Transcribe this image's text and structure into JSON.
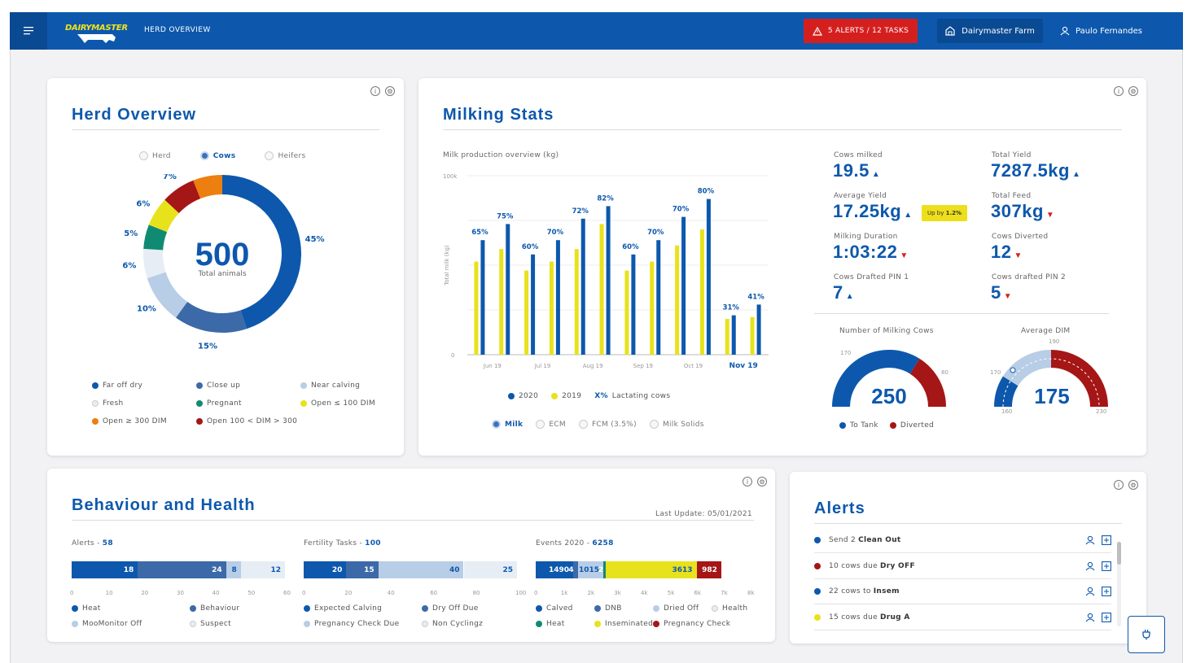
{
  "header": {
    "logo_text": "DAIRYMASTER",
    "breadcrumb": "HERD OVERVIEW",
    "alerts_label": "5 ALERTS / 12 TASKS",
    "farm_label": "Dairymaster Farm",
    "user_name": "Paulo Fernandes"
  },
  "herd": {
    "title": "Herd Overview",
    "radios": [
      "Herd",
      "Cows",
      "Heifers"
    ],
    "selected": "Cows",
    "total": "500",
    "total_label": "Total animals",
    "segments": [
      {
        "label": "Far off dry",
        "pct": "45%",
        "value": 45,
        "color": "#0d58ad"
      },
      {
        "label": "Close up",
        "pct": "15%",
        "value": 15,
        "color": "#3c6aa8"
      },
      {
        "label": "Near calving",
        "pct": "10%",
        "value": 10,
        "color": "#b8cde6"
      },
      {
        "label": "Fresh",
        "pct": "6%",
        "value": 6,
        "color": "#e6edf5"
      },
      {
        "label": "Pregnant",
        "pct": "5%",
        "value": 5,
        "color": "#118a73"
      },
      {
        "label": "Open ≤ 100 DIM",
        "pct": "6%",
        "value": 6,
        "color": "#e8e21c"
      },
      {
        "label": "Open 100 < DIM > 300",
        "pct": "7%",
        "value": 7,
        "color": "#a51616"
      },
      {
        "label": "Open ≥ 300 DIM",
        "pct": "6%",
        "value": 6,
        "color": "#ec7f10"
      }
    ],
    "legend_order": [
      "Far off dry",
      "Close up",
      "Near calving",
      "Fresh",
      "Pregnant",
      "Open ≤ 100 DIM",
      "Open ≥ 300 DIM",
      "Open 100 < DIM > 300"
    ]
  },
  "milking": {
    "title": "Milking Stats",
    "chart_caption": "Milk production overview (kg)",
    "radios": [
      "Milk",
      "ECM",
      "FCM (3.5%)",
      "Milk Solids"
    ],
    "selected": "Milk",
    "legend": {
      "a": "2020",
      "b": "2019",
      "c_bold": "X%",
      "c": "Lactating cows"
    },
    "stats": [
      {
        "label": "Cows milked",
        "value": "19.5",
        "dir": "up"
      },
      {
        "label": "Total Yield",
        "value": "7287.5kg",
        "dir": "up"
      },
      {
        "label": "Average Yield",
        "value": "17.25kg",
        "dir": "up"
      },
      {
        "label": "Total Feed",
        "value": "307kg",
        "dir": "down"
      },
      {
        "label": "Milking Duration",
        "value": "1:03:22",
        "dir": "down"
      },
      {
        "label": "Cows Diverted",
        "value": "12",
        "dir": "down"
      },
      {
        "label": "Cows Drafted PIN 1",
        "value": "7",
        "dir": "up"
      },
      {
        "label": "Cows drafted PIN 2",
        "value": "5",
        "dir": "down"
      }
    ],
    "tooltip": {
      "text": "Up by",
      "value": "1.2%"
    },
    "gauge1": {
      "title": "Number of Milking Cows",
      "value": "250",
      "min_label": "170",
      "max_label": "80",
      "to_tank": 170,
      "diverted": 80,
      "legend": [
        "To Tank",
        "Diverted"
      ]
    },
    "gauge2": {
      "title": "Average DIM",
      "value": "175",
      "labels": [
        "190",
        "170",
        "160",
        "230"
      ],
      "level": 0.5
    }
  },
  "chart_data": {
    "type": "bar",
    "ylabel": "Total milk (kg)",
    "yticks": [
      "100k",
      "0"
    ],
    "ylim": [
      0,
      100000
    ],
    "x_labels": [
      "Jun 19",
      "Jul 19",
      "Aug 19",
      "Sep 19",
      "Oct 19",
      "Nov 19"
    ],
    "series": [
      {
        "name": "2020",
        "values": [
          64000,
          73000,
          56000,
          64000,
          76000,
          83000,
          56000,
          64000,
          77000,
          87000,
          22000,
          28000
        ]
      },
      {
        "name": "2019",
        "values": [
          52000,
          59000,
          47000,
          52000,
          59000,
          73000,
          47000,
          52000,
          61000,
          70000,
          20000,
          21000
        ]
      }
    ],
    "annotations": [
      "65%",
      "75%",
      "60%",
      "70%",
      "72%",
      "82%",
      "60%",
      "70%",
      "70%",
      "80%",
      "31%",
      "41%"
    ]
  },
  "behaviour": {
    "title": "Behaviour and Health",
    "last_update": "Last Update: 05/01/2021",
    "groups": [
      {
        "label": "Alerts - ",
        "total": "58",
        "max": 60,
        "ticks": [
          "0",
          "10",
          "20",
          "30",
          "40",
          "50",
          "60"
        ],
        "segments": [
          {
            "v": 18,
            "t": "18",
            "c": "#0d58ad"
          },
          {
            "v": 24,
            "t": "24",
            "c": "#3c6aa8"
          },
          {
            "v": 4,
            "t": "8",
            "c": "#b8cde6"
          },
          {
            "v": 12,
            "t": "12",
            "c": "#e6edf5"
          }
        ],
        "legend": [
          {
            "t": "Heat",
            "c": "#0d58ad"
          },
          {
            "t": "Behaviour",
            "c": "#3c6aa8"
          },
          {
            "t": "MooMonitor Off",
            "c": "#b8cde6"
          },
          {
            "t": "Suspect",
            "c": "#e6edf5"
          }
        ]
      },
      {
        "label": "Fertility Tasks - ",
        "total": "100",
        "max": 100,
        "ticks": [
          "0",
          "20",
          "40",
          "60",
          "80",
          "100"
        ],
        "segments": [
          {
            "v": 20,
            "t": "20",
            "c": "#0d58ad"
          },
          {
            "v": 15,
            "t": "15",
            "c": "#3c6aa8"
          },
          {
            "v": 40,
            "t": "40",
            "c": "#b8cde6"
          },
          {
            "v": 25,
            "t": "25",
            "c": "#e6edf5"
          }
        ],
        "legend": [
          {
            "t": "Expected Calving",
            "c": "#0d58ad"
          },
          {
            "t": "Dry Off Due",
            "c": "#3c6aa8"
          },
          {
            "t": "Pregnancy Check Due",
            "c": "#b8cde6"
          },
          {
            "t": "Non Cyclingz",
            "c": "#e6edf5"
          }
        ]
      },
      {
        "label": "Events 2020 - ",
        "total": "6258",
        "max": 8000,
        "ticks": [
          "0",
          "1k",
          "2k",
          "3k",
          "4k",
          "5k",
          "6k",
          "7k",
          "8k"
        ],
        "segments": [
          {
            "v": 1490,
            "t": "1490",
            "c": "#0d58ad"
          },
          {
            "v": 180,
            "t": "4",
            "c": "#3c6aa8"
          },
          {
            "v": 1015,
            "t": "1015",
            "c": "#b8cde6"
          },
          {
            "v": 90,
            "t": "2",
            "c": "#118a73"
          },
          {
            "v": 3613,
            "t": "3613",
            "c": "#e8e21c"
          },
          {
            "v": 982,
            "t": "982",
            "c": "#a51616"
          }
        ],
        "legend": [
          {
            "t": "Calved",
            "c": "#0d58ad"
          },
          {
            "t": "DNB",
            "c": "#3c6aa8"
          },
          {
            "t": "Dried Off",
            "c": "#b8cde6"
          },
          {
            "t": "Health",
            "c": "#e6edf5"
          },
          {
            "t": "Heat",
            "c": "#118a73"
          },
          {
            "t": "Inseminated",
            "c": "#e8e21c"
          },
          {
            "t": "Pregnancy Check",
            "c": "#a51616"
          }
        ]
      }
    ]
  },
  "alerts": {
    "title": "Alerts",
    "items": [
      {
        "pre": "Send 2",
        "bold": "Clean Out",
        "post": "",
        "color": "#0d58ad"
      },
      {
        "pre": "10 cows due",
        "bold": "Dry OFF",
        "post": "",
        "color": "#a51616"
      },
      {
        "pre": "22 cows to",
        "bold": "Insem",
        "post": "",
        "color": "#0d58ad"
      },
      {
        "pre": "15 cows due",
        "bold": "Drug A",
        "post": "",
        "color": "#e8e21c"
      }
    ]
  }
}
